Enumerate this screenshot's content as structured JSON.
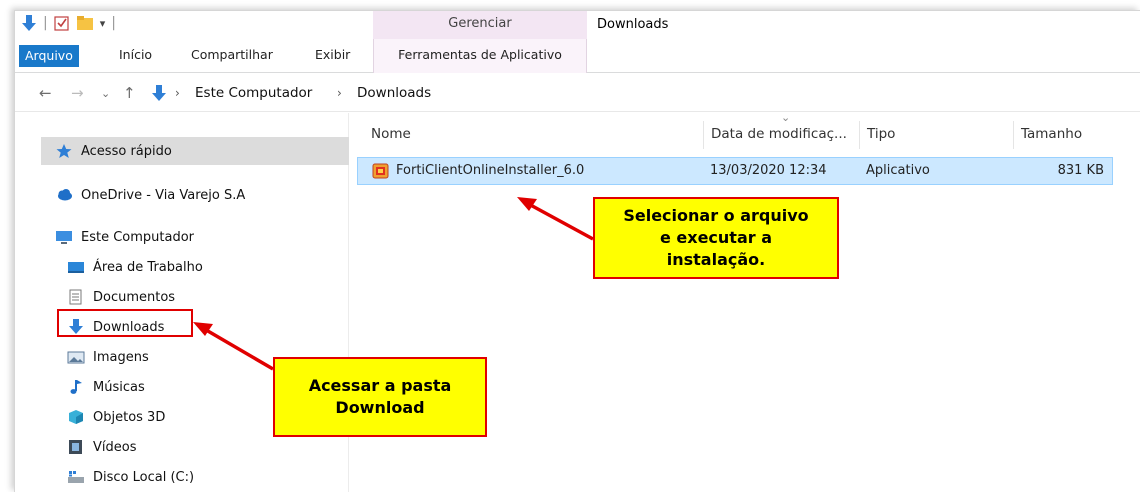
{
  "ribbon": {
    "context_group": "Gerenciar",
    "window_title": "Downloads",
    "tabs": [
      "Arquivo",
      "Início",
      "Compartilhar",
      "Exibir"
    ],
    "context_tab": "Ferramentas de Aplicativo"
  },
  "address": {
    "crumbs": [
      "Este Computador",
      "Downloads"
    ]
  },
  "nav": {
    "quick_access": "Acesso rápido",
    "onedrive": "OneDrive - Via Varejo S.A",
    "this_pc": "Este Computador",
    "items": [
      {
        "label": "Área de Trabalho",
        "icon": "desktop-icon"
      },
      {
        "label": "Documentos",
        "icon": "documents-icon"
      },
      {
        "label": "Downloads",
        "icon": "download-arrow-icon"
      },
      {
        "label": "Imagens",
        "icon": "pictures-icon"
      },
      {
        "label": "Músicas",
        "icon": "music-icon"
      },
      {
        "label": "Objetos 3D",
        "icon": "3d-objects-icon"
      },
      {
        "label": "Vídeos",
        "icon": "videos-icon"
      },
      {
        "label": "Disco Local (C:)",
        "icon": "local-disk-icon"
      }
    ]
  },
  "files": {
    "columns": {
      "name": "Nome",
      "date": "Data de modificaç...",
      "type": "Tipo",
      "size": "Tamanho"
    },
    "rows": [
      {
        "name": "FortiClientOnlineInstaller_6.0",
        "date": "13/03/2020 12:34",
        "type": "Aplicativo",
        "size": "831 KB"
      }
    ]
  },
  "annotations": {
    "select_file": [
      "Selecionar o arquivo",
      "e executar a",
      "instalação."
    ],
    "open_folder": [
      "Acessar a pasta",
      "Download"
    ]
  },
  "colors": {
    "file_tab": "#1979ca",
    "selection": "#cce8ff",
    "callout_fill": "#ffff00",
    "callout_border": "#e00000"
  }
}
